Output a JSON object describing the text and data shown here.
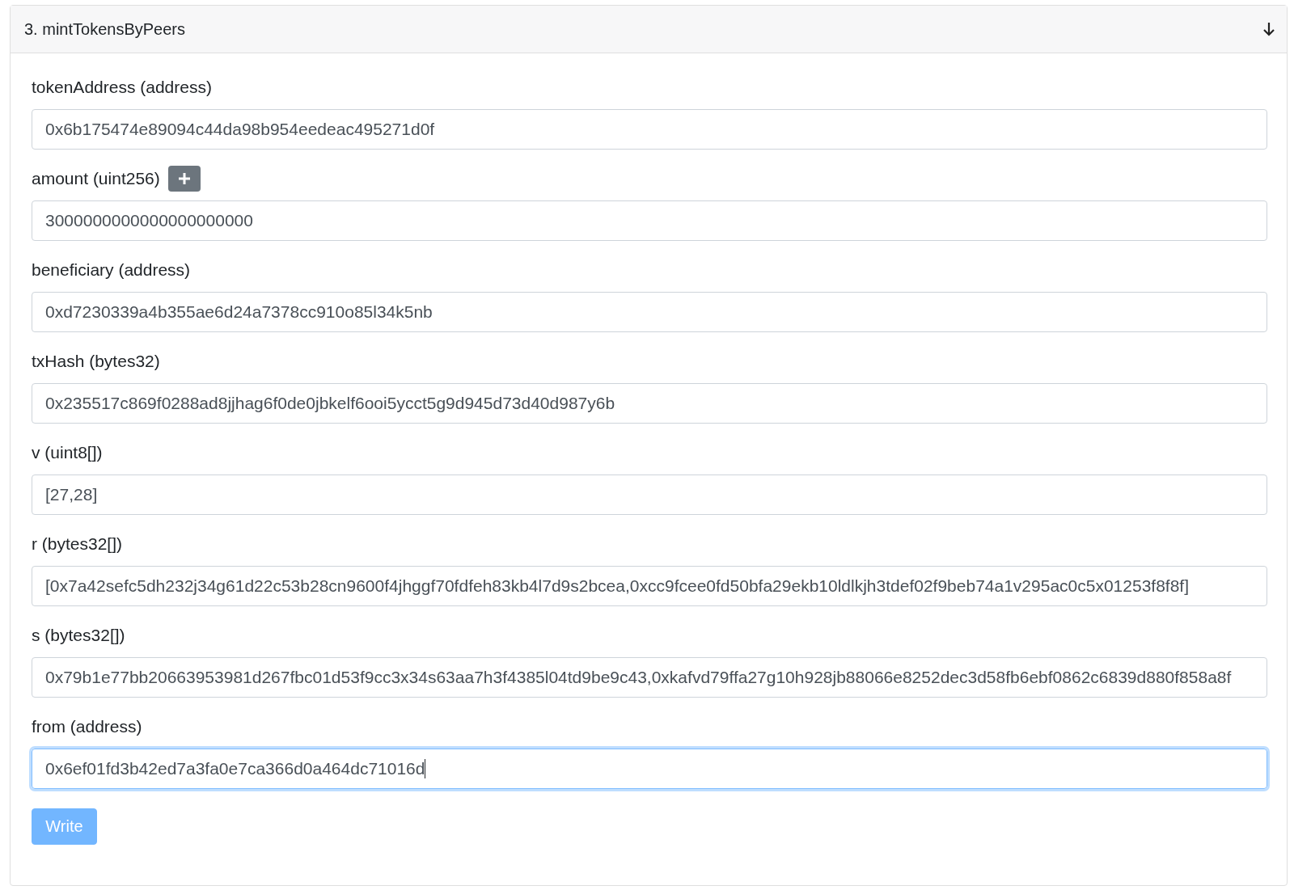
{
  "panel": {
    "title": "3. mintTokensByPeers",
    "expanded": true
  },
  "fields": [
    {
      "label": "tokenAddress (address)",
      "value": "0x6b175474e89094c44da98b954eedeac495271d0f",
      "add_button": false,
      "focused": false
    },
    {
      "label": "amount (uint256)",
      "value": "3000000000000000000000",
      "add_button": true,
      "focused": false
    },
    {
      "label": "beneficiary (address)",
      "value": "0xd7230339a4b355ae6d24a7378cc910o85l34k5nb",
      "add_button": false,
      "focused": false
    },
    {
      "label": "txHash (bytes32)",
      "value": "0x235517c869f0288ad8jjhag6f0de0jbkelf6ooi5ycct5g9d945d73d40d987y6b",
      "add_button": false,
      "focused": false
    },
    {
      "label": "v (uint8[])",
      "value": "[27,28]",
      "add_button": false,
      "focused": false
    },
    {
      "label": "r (bytes32[])",
      "value": "[0x7a42sefc5dh232j34g61d22c53b28cn9600f4jhggf70fdfeh83kb4l7d9s2bcea,0xcc9fcee0fd50bfa29ekb10ldlkjh3tdef02f9beb74a1v295ac0c5x01253f8f8f]",
      "add_button": false,
      "focused": false
    },
    {
      "label": "s (bytes32[])",
      "value": "0x79b1e77bb20663953981d267fbc01d53f9cc3x34s63aa7h3f4385l04td9be9c43,0xkafvd79ffa27g10h928jb88066e8252dec3d58fb6ebf0862c6839d880f858a8f",
      "add_button": false,
      "focused": false
    },
    {
      "label": "from (address)",
      "value": "0x6ef01fd3b42ed7a3fa0e7ca366d0a464dc71016d",
      "add_button": false,
      "focused": true
    }
  ],
  "write_button": {
    "label": "Write",
    "disabled": true
  }
}
